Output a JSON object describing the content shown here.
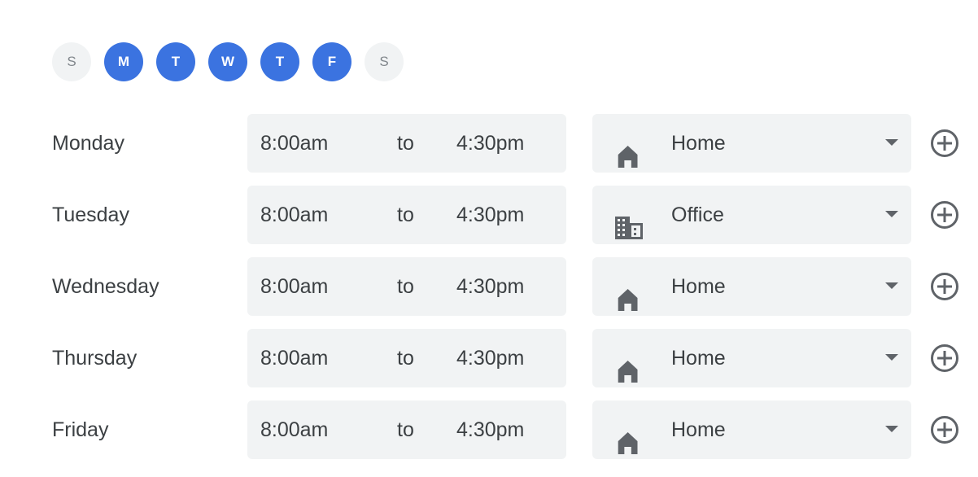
{
  "days": [
    {
      "letter": "S",
      "selected": false
    },
    {
      "letter": "M",
      "selected": true
    },
    {
      "letter": "T",
      "selected": true
    },
    {
      "letter": "W",
      "selected": true
    },
    {
      "letter": "T",
      "selected": true
    },
    {
      "letter": "F",
      "selected": true
    },
    {
      "letter": "S",
      "selected": false
    }
  ],
  "colors": {
    "accent": "#3b73e0",
    "field_bg": "#f1f3f4"
  },
  "rows": [
    {
      "day": "Monday",
      "start": "8:00am",
      "sep": "to",
      "end": "4:30pm",
      "location": "Home",
      "icon": "home-icon"
    },
    {
      "day": "Tuesday",
      "start": "8:00am",
      "sep": "to",
      "end": "4:30pm",
      "location": "Office",
      "icon": "building-icon"
    },
    {
      "day": "Wednesday",
      "start": "8:00am",
      "sep": "to",
      "end": "4:30pm",
      "location": "Home",
      "icon": "home-icon"
    },
    {
      "day": "Thursday",
      "start": "8:00am",
      "sep": "to",
      "end": "4:30pm",
      "location": "Home",
      "icon": "home-icon"
    },
    {
      "day": "Friday",
      "start": "8:00am",
      "sep": "to",
      "end": "4:30pm",
      "location": "Home",
      "icon": "home-icon"
    }
  ]
}
